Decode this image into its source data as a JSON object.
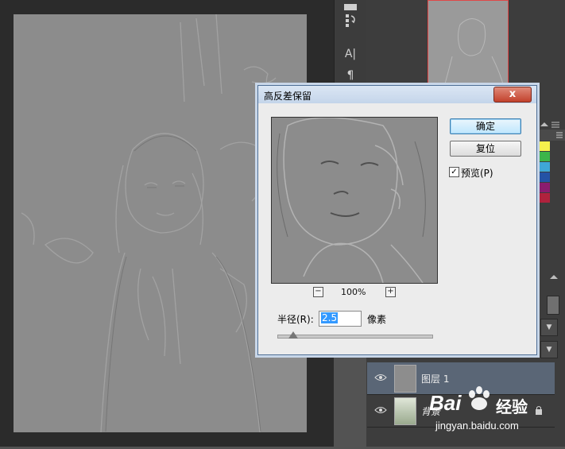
{
  "dialog": {
    "title": "高反差保留",
    "close_symbol": "x",
    "ok_label": "确定",
    "reset_label": "复位",
    "preview_checked": true,
    "preview_check_symbol": "✓",
    "preview_label": "预览(P)",
    "zoom_out_symbol": "−",
    "zoom_in_symbol": "+",
    "zoom_level": "100%",
    "radius_label": "半径(R):",
    "radius_value": "2.5",
    "radius_unit": "像素",
    "radius_slider_fraction": 0.1
  },
  "toolbar": {
    "tools": [
      {
        "icon": "text-tool-icon",
        "glyph": "A|"
      },
      {
        "icon": "paragraph-icon",
        "glyph": "¶"
      }
    ]
  },
  "layers": [
    {
      "name": "图层 1",
      "selected": true
    },
    {
      "name": "背景",
      "locked": true,
      "selected": false
    }
  ],
  "watermark": {
    "brand": "Bai",
    "brand_suffix": "经验",
    "url": "jingyan.baidu.com"
  },
  "colors": {
    "dialog_bg": "#ececec",
    "selection": "#3399ff",
    "selected_layer": "#5a6676",
    "swatches": [
      "#f6f24d",
      "#3cb54a",
      "#3fa7d6",
      "#2453a5",
      "#8b1c6e",
      "#b0223d"
    ]
  }
}
